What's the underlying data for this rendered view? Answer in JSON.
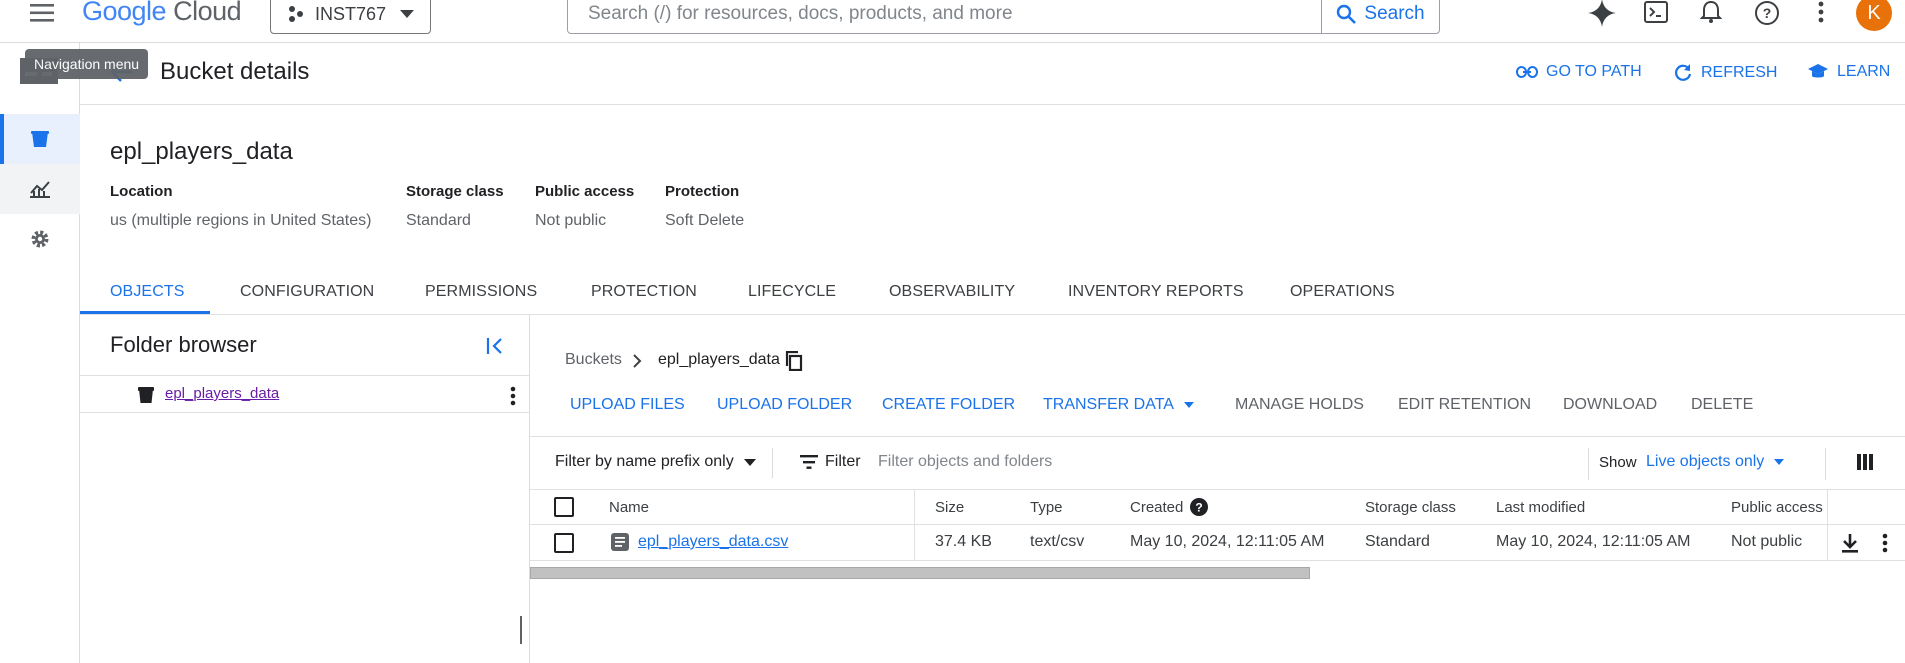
{
  "topbar": {
    "logo_google": "Google",
    "logo_cloud": "Cloud",
    "project": "INST767",
    "search_placeholder": "Search (/) for resources, docs, products, and more",
    "search_button": "Search",
    "avatar_letter": "K"
  },
  "tooltip": {
    "text": "Navigation menu"
  },
  "header": {
    "title": "Bucket details",
    "go_to_path": "GO TO PATH",
    "refresh": "REFRESH",
    "learn": "LEARN"
  },
  "bucket": {
    "name": "epl_players_data",
    "props": [
      {
        "label": "Location",
        "value": "us (multiple regions in United States)"
      },
      {
        "label": "Storage class",
        "value": "Standard"
      },
      {
        "label": "Public access",
        "value": "Not public"
      },
      {
        "label": "Protection",
        "value": "Soft Delete"
      }
    ]
  },
  "tabs": [
    "OBJECTS",
    "CONFIGURATION",
    "PERMISSIONS",
    "PROTECTION",
    "LIFECYCLE",
    "OBSERVABILITY",
    "INVENTORY REPORTS",
    "OPERATIONS"
  ],
  "folder_browser": {
    "title": "Folder browser",
    "item": "epl_players_data"
  },
  "breadcrumb": {
    "root": "Buckets",
    "current": "epl_players_data"
  },
  "actions": {
    "upload_files": "UPLOAD FILES",
    "upload_folder": "UPLOAD FOLDER",
    "create_folder": "CREATE FOLDER",
    "transfer_data": "TRANSFER DATA",
    "manage_holds": "MANAGE HOLDS",
    "edit_retention": "EDIT RETENTION",
    "download": "DOWNLOAD",
    "delete": "DELETE"
  },
  "filterbar": {
    "prefix_select": "Filter by name prefix only",
    "filter_label": "Filter",
    "filter_placeholder": "Filter objects and folders",
    "show_label": "Show",
    "show_value": "Live objects only"
  },
  "table": {
    "headers": [
      "Name",
      "Size",
      "Type",
      "Created",
      "Storage class",
      "Last modified",
      "Public access"
    ],
    "rows": [
      {
        "name": "epl_players_data.csv",
        "size": "37.4 KB",
        "type": "text/csv",
        "created": "May 10, 2024, 12:11:05 AM",
        "storage_class": "Standard",
        "last_modified": "May 10, 2024, 12:11:05 AM",
        "public_access": "Not public"
      }
    ]
  },
  "colors": {
    "accent": "#1a73e8",
    "avatar": "#e8710a",
    "visited_link": "#681da8"
  }
}
